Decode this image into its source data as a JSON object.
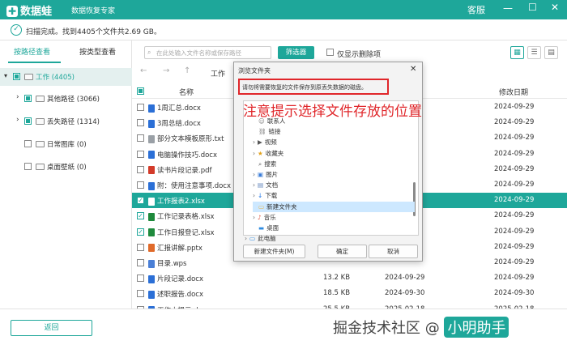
{
  "app": {
    "brand": "数据蛙",
    "subtitle": "数据恢复专家",
    "service_label": "客服"
  },
  "status": {
    "text": "扫描完成。找到4405个文件共2.69 GB。"
  },
  "sidebar": {
    "tabs": [
      "按路径查看",
      "按类型查看"
    ],
    "tree": [
      {
        "label": "工作 (4405)"
      },
      {
        "label": "其他路径 (3066)"
      },
      {
        "label": "丢失路径 (1314)"
      },
      {
        "label": "日常图库 (0)"
      },
      {
        "label": "桌面壁纸 (0)"
      }
    ]
  },
  "toolbar": {
    "search_placeholder": "在此处输入文件名称或保存路径",
    "filter_label": "筛选器",
    "only_deleted_label": "仅显示删除项"
  },
  "nav": {
    "current_path": "工作"
  },
  "table": {
    "headers": {
      "name": "名称",
      "modified": "修改日期"
    },
    "rows": [
      {
        "name": "1周汇总.docx",
        "size": "",
        "created": "",
        "modified": "2024-09-29",
        "icon": "word",
        "checked": false,
        "selected": false
      },
      {
        "name": "3周总结.docx",
        "size": "",
        "created": "",
        "modified": "2024-09-29",
        "icon": "word",
        "checked": false,
        "selected": false
      },
      {
        "name": "部分文本模板原形.txt",
        "size": "",
        "created": "",
        "modified": "2024-09-29",
        "icon": "txt",
        "checked": false,
        "selected": false
      },
      {
        "name": "电脑操作技巧.docx",
        "size": "",
        "created": "",
        "modified": "2024-09-29",
        "icon": "word",
        "checked": false,
        "selected": false
      },
      {
        "name": "读书片段记录.pdf",
        "size": "",
        "created": "",
        "modified": "2024-09-29",
        "icon": "pdf",
        "checked": false,
        "selected": false
      },
      {
        "name": "附：使用注意事项.docx",
        "size": "",
        "created": "",
        "modified": "2024-09-29",
        "icon": "word",
        "checked": false,
        "selected": false
      },
      {
        "name": "工作报表2.xlsx",
        "size": "",
        "created": "",
        "modified": "2024-09-29",
        "icon": "excel",
        "checked": true,
        "selected": true
      },
      {
        "name": "工作记录表格.xlsx",
        "size": "",
        "created": "",
        "modified": "2024-09-29",
        "icon": "excel",
        "checked": true,
        "selected": false
      },
      {
        "name": "工作日报登记.xlsx",
        "size": "",
        "created": "",
        "modified": "2024-09-29",
        "icon": "excel",
        "checked": true,
        "selected": false
      },
      {
        "name": "汇报讲解.pptx",
        "size": "",
        "created": "",
        "modified": "2024-09-29",
        "icon": "ppt",
        "checked": false,
        "selected": false
      },
      {
        "name": "目录.wps",
        "size": "",
        "created": "",
        "modified": "2024-09-29",
        "icon": "wps",
        "checked": false,
        "selected": false
      },
      {
        "name": "片段记录.docx",
        "size": "13.2 KB",
        "created": "2024-09-29",
        "modified": "2024-09-29",
        "icon": "word",
        "checked": false,
        "selected": false
      },
      {
        "name": "述职报告.docx",
        "size": "18.5 KB",
        "created": "2024-09-30",
        "modified": "2024-09-30",
        "icon": "word",
        "checked": false,
        "selected": false
      },
      {
        "name": "工作小提示.docx",
        "size": "25.5 KB",
        "created": "2025-02-18",
        "modified": "2025-02-18",
        "icon": "word",
        "checked": false,
        "selected": false
      }
    ]
  },
  "dialog": {
    "title": "浏览文件夹",
    "warning": "请勿将需要恢复的文件保存到原丢失数据的磁盘。",
    "items": [
      {
        "label": "联系人",
        "icon": "contact"
      },
      {
        "label": "链接",
        "icon": "link"
      },
      {
        "label": "视频",
        "icon": "video"
      },
      {
        "label": "收藏夹",
        "icon": "star"
      },
      {
        "label": "搜索",
        "icon": "search"
      },
      {
        "label": "图片",
        "icon": "image"
      },
      {
        "label": "文档",
        "icon": "doc"
      },
      {
        "label": "下载",
        "icon": "download"
      },
      {
        "label": "新建文件夹",
        "icon": "folder"
      },
      {
        "label": "音乐",
        "icon": "music"
      },
      {
        "label": "桌面",
        "icon": "desktop"
      },
      {
        "label": "此电脑",
        "icon": "pc"
      }
    ],
    "new_folder_label": "新建文件夹(M)",
    "ok_label": "确定",
    "cancel_label": "取消"
  },
  "annotation": {
    "text": "注意提示选择文件存放的位置"
  },
  "footer": {
    "back_label": "返回"
  },
  "watermark": {
    "text": "掘金技术社区 @ ",
    "badge": "小明助手"
  },
  "colors": {
    "accent": "#1ea79a",
    "annotation": "#e0262a"
  }
}
